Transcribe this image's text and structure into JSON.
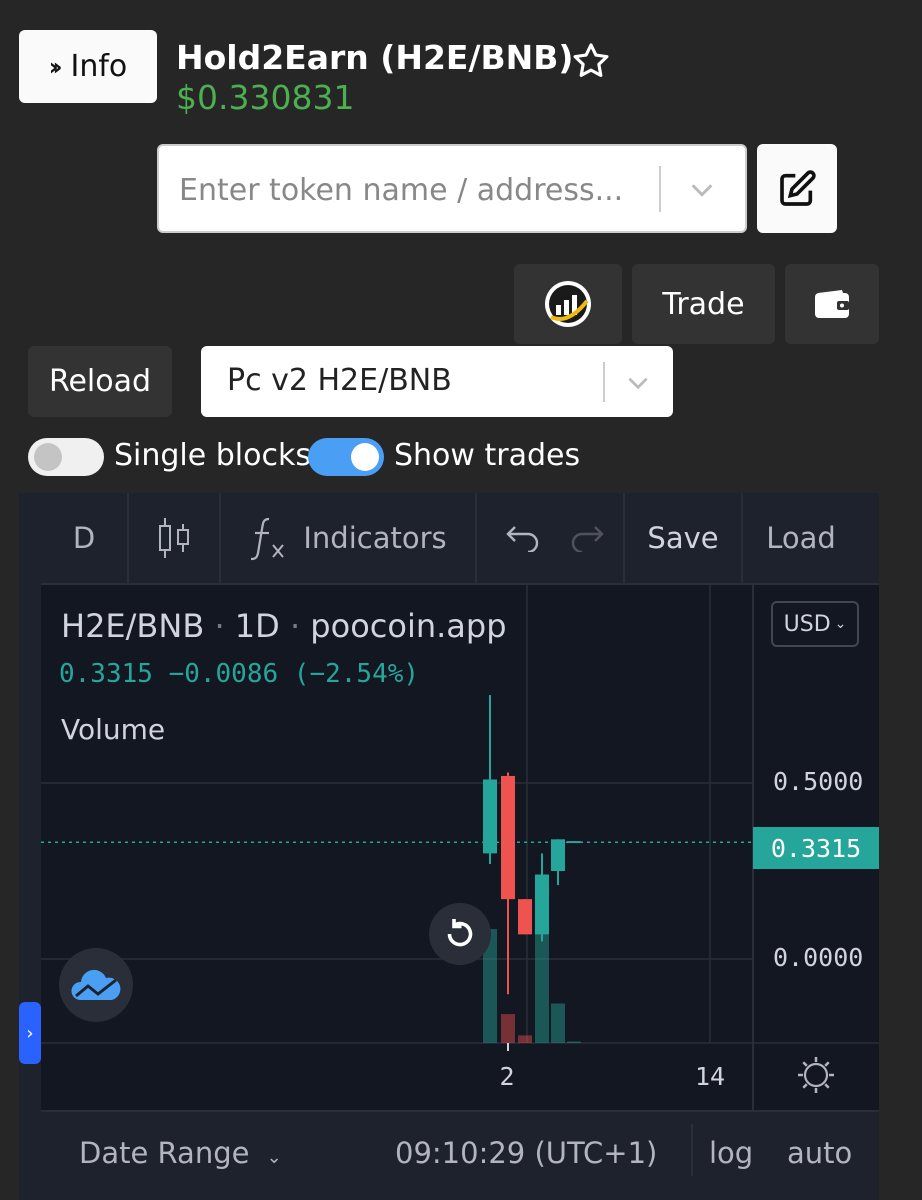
{
  "header": {
    "info_label": "Info",
    "title": "Hold2Earn (H2E/BNB)",
    "price": "$0.330831"
  },
  "search": {
    "placeholder": "Enter token name / address..."
  },
  "toolbar": {
    "trade_label": "Trade",
    "reload_label": "Reload",
    "pair_selected": "Pc v2 H2E/BNB"
  },
  "toggles": {
    "single_blocks": {
      "label": "Single blocks",
      "on": false
    },
    "show_trades": {
      "label": "Show trades",
      "on": true
    }
  },
  "chart": {
    "toolbar": {
      "interval": "D",
      "indicators": "Indicators",
      "save": "Save",
      "load": "Load"
    },
    "legend": {
      "symbol": "H2E/BNB",
      "sep": "·",
      "interval": "1D",
      "source": "poocoin.app",
      "values": "0.3315 −0.0086 (−2.54%)",
      "volume": "Volume"
    },
    "currency": "USD",
    "price_axis": {
      "top": "0.5000",
      "current": "0.3315",
      "bottom": "0.0000"
    },
    "time_axis": {
      "a": "2",
      "b": "14"
    },
    "bottom_bar": {
      "date_range": "Date Range",
      "clock": "09:10:29 (UTC+1)",
      "log": "log",
      "auto": "auto"
    },
    "colors": {
      "up": "#26a69a",
      "down": "#ef5350"
    }
  },
  "chart_data": {
    "type": "candlestick",
    "candles": [
      {
        "open": 0.3,
        "high": 0.75,
        "low": 0.27,
        "close": 0.51,
        "dir": "up"
      },
      {
        "open": 0.52,
        "high": 0.53,
        "low": -0.1,
        "close": 0.17,
        "dir": "down"
      },
      {
        "open": 0.17,
        "high": 0.17,
        "low": 0.07,
        "close": 0.07,
        "dir": "down"
      },
      {
        "open": 0.07,
        "high": 0.3,
        "low": 0.05,
        "close": 0.24,
        "dir": "up"
      },
      {
        "open": 0.25,
        "high": 0.34,
        "low": 0.21,
        "close": 0.34,
        "dir": "up"
      },
      {
        "open": 0.335,
        "high": 0.335,
        "low": 0.33,
        "close": 0.3315,
        "dir": "up"
      }
    ],
    "volumes": [
      {
        "v": 0.75,
        "dir": "up"
      },
      {
        "v": 0.19,
        "dir": "down"
      },
      {
        "v": 0.05,
        "dir": "down"
      },
      {
        "v": 0.72,
        "dir": "up"
      },
      {
        "v": 0.26,
        "dir": "up"
      },
      {
        "v": 0.01,
        "dir": "up"
      }
    ],
    "y_ticks": [
      0.5,
      0.0
    ],
    "current_price": 0.3315,
    "x_ticks": [
      "2",
      "14"
    ]
  }
}
